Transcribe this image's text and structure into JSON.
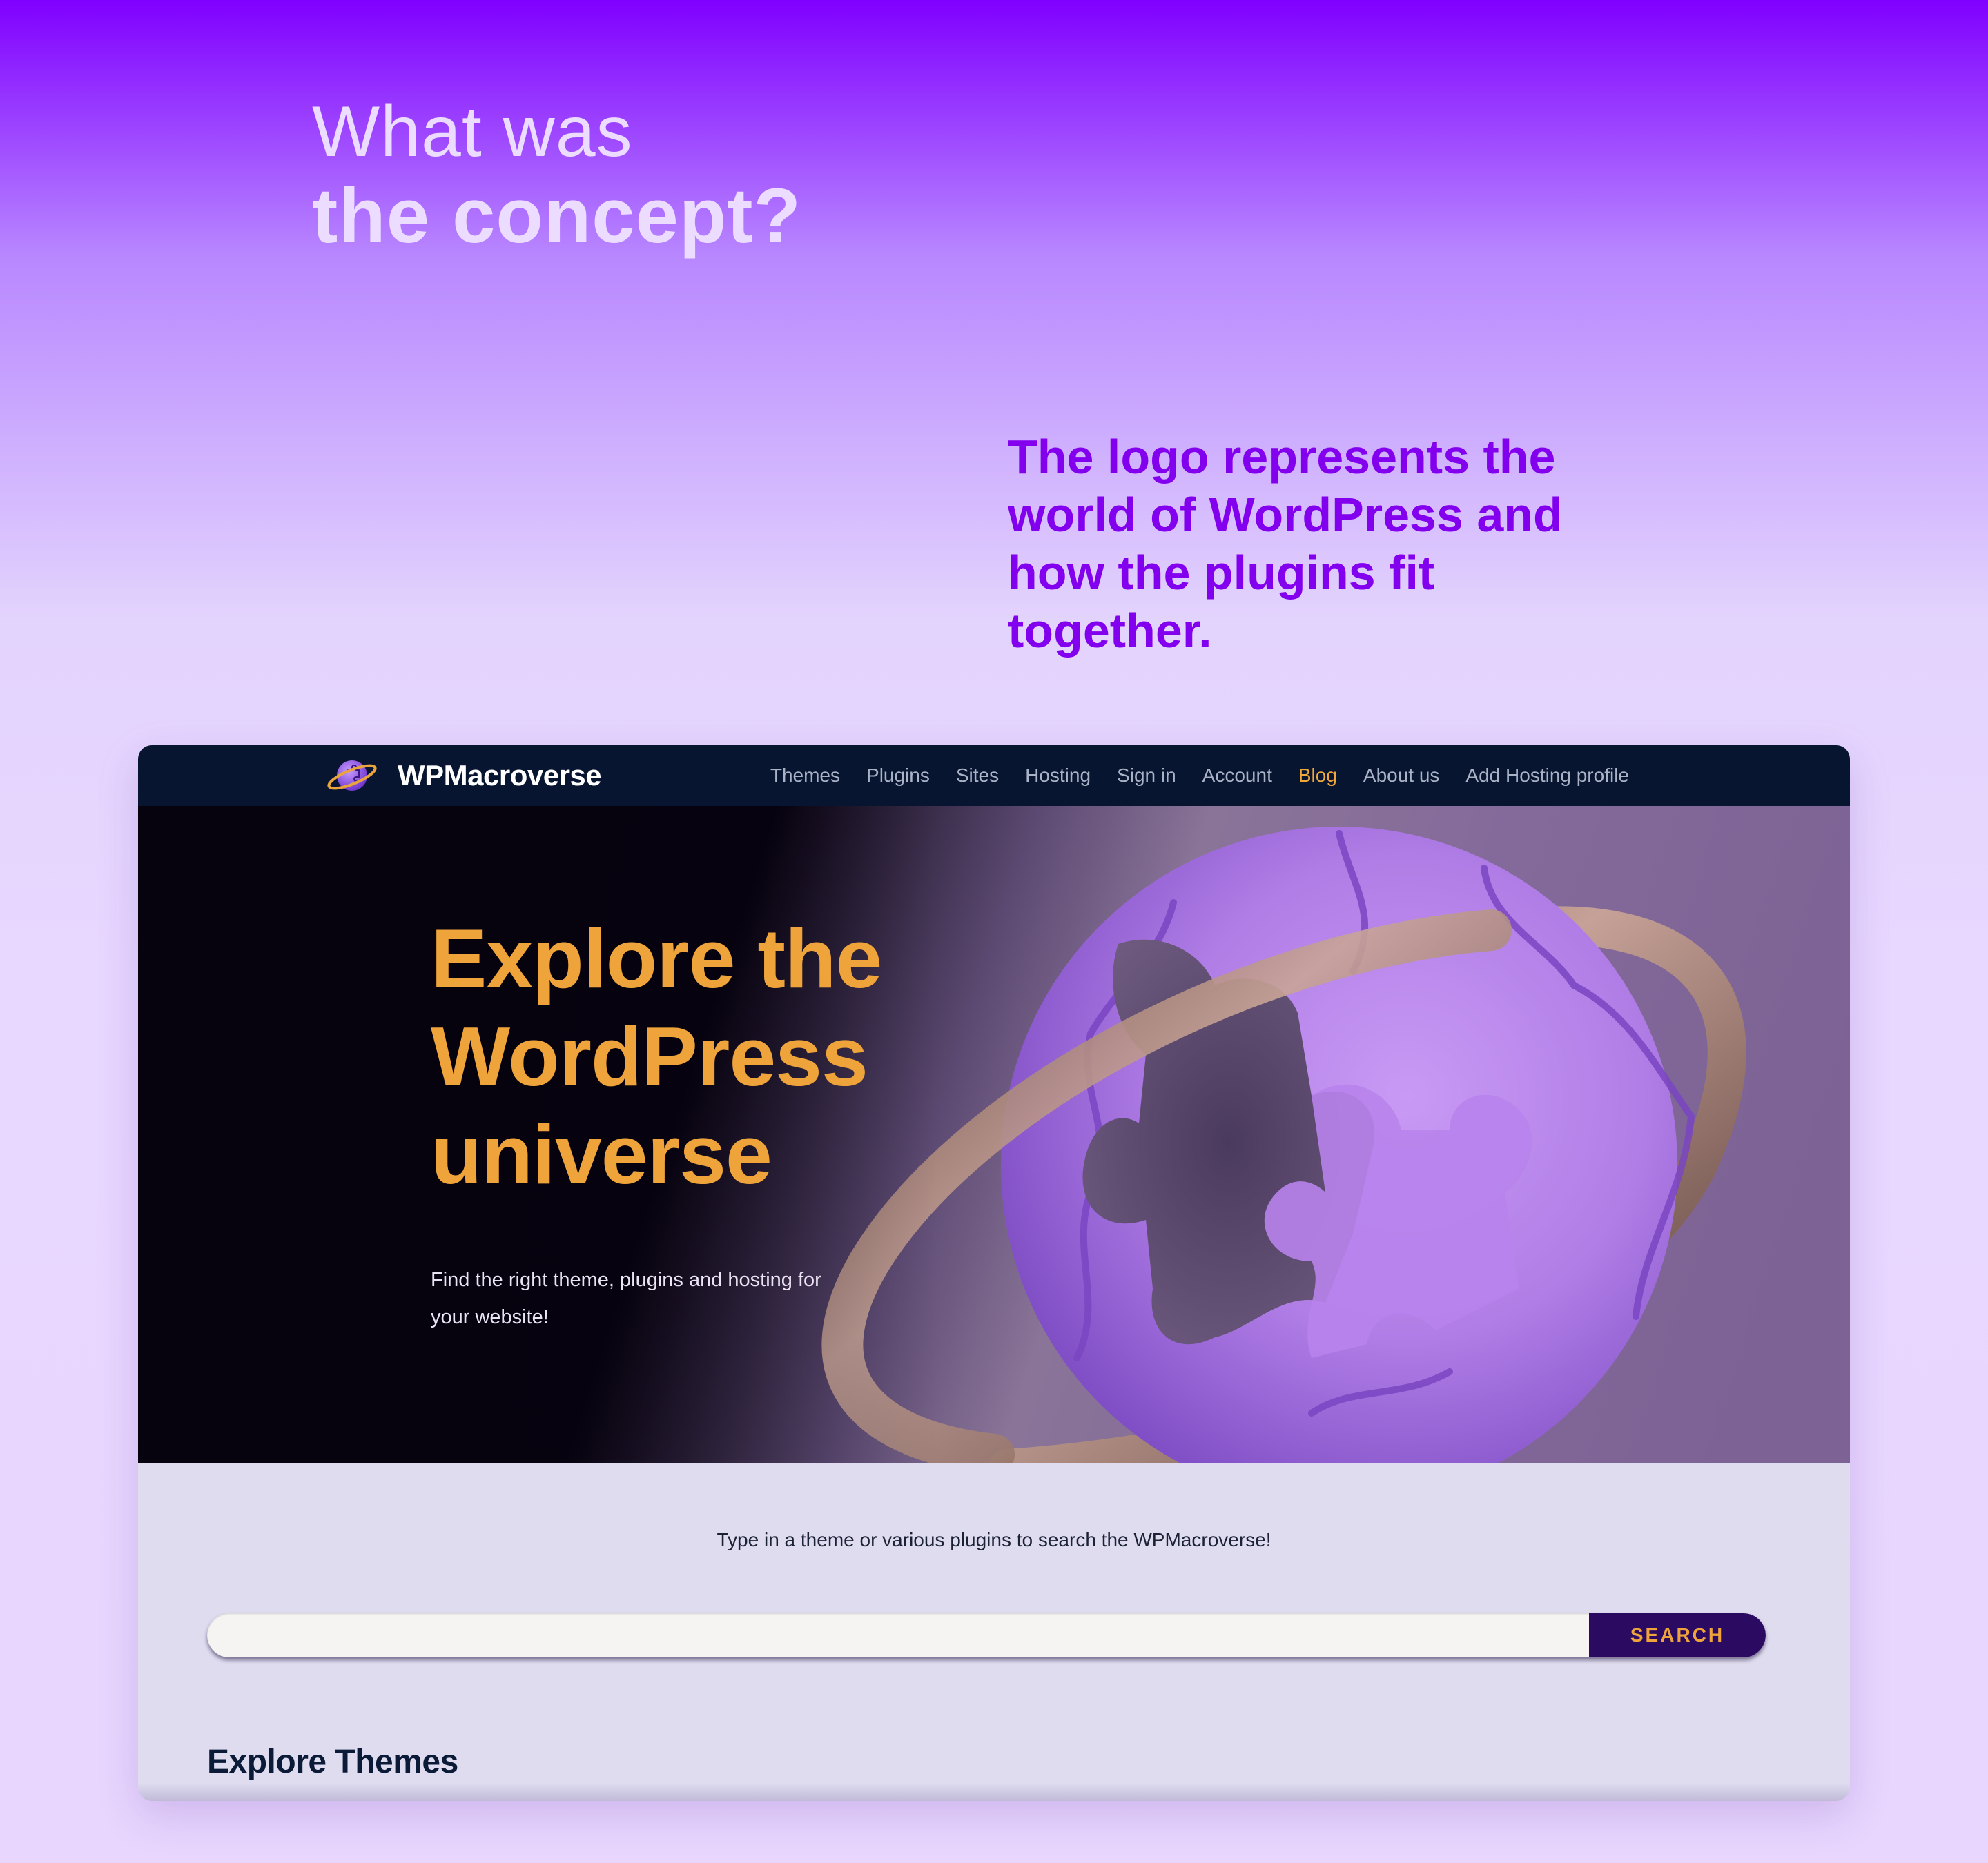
{
  "concept": {
    "heading_line1": "What was",
    "heading_line2": "the concept?",
    "description": "The logo represents the world of WordPress and how the plugins fit together."
  },
  "site": {
    "brand": "WPMacroverse",
    "logo_icon": "planet-puzzle-icon",
    "nav": [
      {
        "label": "Themes"
      },
      {
        "label": "Plugins"
      },
      {
        "label": "Sites"
      },
      {
        "label": "Hosting"
      },
      {
        "label": "Sign in"
      },
      {
        "label": "Account"
      },
      {
        "label": "Blog",
        "active": true
      },
      {
        "label": "About us"
      },
      {
        "label": "Add Hosting profile"
      }
    ],
    "hero": {
      "title": "Explore the WordPress universe",
      "subtitle": "Find the right theme, plugins and hosting for your website!",
      "image": "puzzle-planet-illustration"
    },
    "search": {
      "hint": "Type in a theme or various plugins to search the WPMacroverse!",
      "input_value": "",
      "placeholder": "",
      "button_label": "SEARCH"
    },
    "sections": {
      "themes_title": "Explore Themes"
    }
  },
  "colors": {
    "accent_orange": "#efa43b",
    "brand_purple": "#8300ee",
    "nav_background": "#071530",
    "search_button": "#2a0b61"
  }
}
